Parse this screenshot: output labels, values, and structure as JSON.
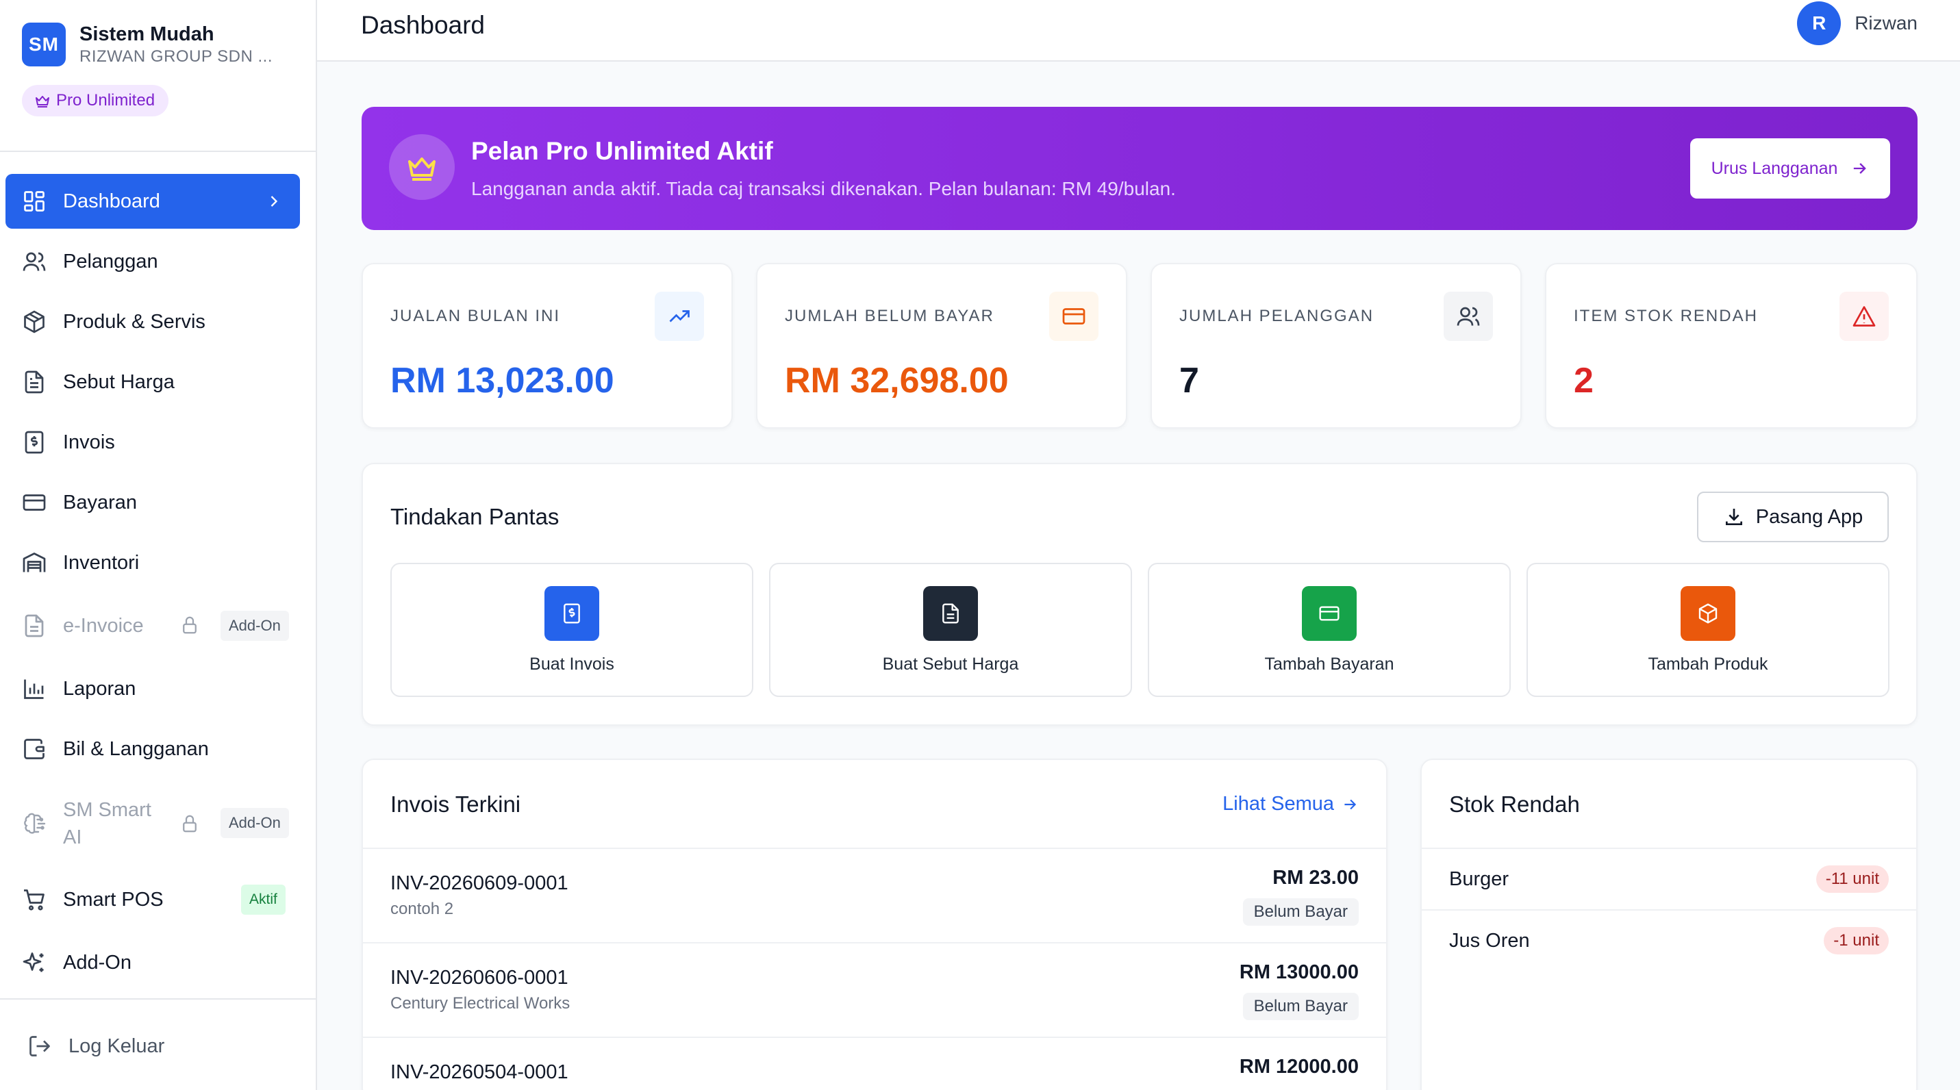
{
  "brand": {
    "logo_text": "SM",
    "name": "Sistem Mudah",
    "company": "RIZWAN GROUP SDN ...",
    "plan_badge": "Pro Unlimited"
  },
  "sidebar": {
    "items": [
      {
        "label": "Dashboard",
        "icon": "grid-icon",
        "active": true
      },
      {
        "label": "Pelanggan",
        "icon": "users-icon"
      },
      {
        "label": "Produk & Servis",
        "icon": "box-icon"
      },
      {
        "label": "Sebut Harga",
        "icon": "document-icon"
      },
      {
        "label": "Invois",
        "icon": "invoice-icon"
      },
      {
        "label": "Bayaran",
        "icon": "credit-card-icon"
      },
      {
        "label": "Inventori",
        "icon": "warehouse-icon"
      },
      {
        "label": "e-Invoice",
        "icon": "document-icon",
        "locked": true,
        "tag": "Add-On"
      },
      {
        "label": "Laporan",
        "icon": "bar-chart-icon"
      },
      {
        "label": "Bil & Langganan",
        "icon": "wallet-icon"
      },
      {
        "label_line1": "SM Smart",
        "label_line2": "AI",
        "icon": "brain-icon",
        "locked": true,
        "tag": "Add-On"
      },
      {
        "label": "Smart POS",
        "icon": "cart-icon",
        "tag": "Aktif"
      },
      {
        "label": "Add-On",
        "icon": "sparkles-icon"
      }
    ],
    "logout_label": "Log Keluar"
  },
  "header": {
    "title": "Dashboard",
    "user_initial": "R",
    "user_name": "Rizwan"
  },
  "banner": {
    "title": "Pelan Pro Unlimited Aktif",
    "description": "Langganan anda aktif. Tiada caj transaksi dikenakan. Pelan bulanan: RM 49/bulan.",
    "button_label": "Urus Langganan"
  },
  "stats": [
    {
      "label": "JUALAN BULAN INI",
      "value": "RM 13,023.00",
      "icon": "trending-up-icon",
      "color": "#2563eb"
    },
    {
      "label": "JUMLAH BELUM BAYAR",
      "value": "RM 32,698.00",
      "icon": "credit-card-icon",
      "color": "#ea580c"
    },
    {
      "label": "JUMLAH PELANGGAN",
      "value": "7",
      "icon": "users-icon",
      "color": "#111827"
    },
    {
      "label": "ITEM STOK RENDAH",
      "value": "2",
      "icon": "alert-triangle-icon",
      "color": "#dc2626"
    }
  ],
  "quick_actions": {
    "title": "Tindakan Pantas",
    "install_label": "Pasang App",
    "items": [
      {
        "label": "Buat Invois",
        "icon": "invoice-icon",
        "color": "#2563eb"
      },
      {
        "label": "Buat Sebut Harga",
        "icon": "document-icon",
        "color": "#1f2937"
      },
      {
        "label": "Tambah Bayaran",
        "icon": "credit-card-icon",
        "color": "#16a34a"
      },
      {
        "label": "Tambah Produk",
        "icon": "box-icon",
        "color": "#ea580c"
      }
    ]
  },
  "recent_invoices": {
    "title": "Invois Terkini",
    "see_all": "Lihat Semua",
    "rows": [
      {
        "number": "INV-20260609-0001",
        "customer": "contoh 2",
        "amount": "RM 23.00",
        "status": "Belum Bayar"
      },
      {
        "number": "INV-20260606-0001",
        "customer": "Century Electrical Works",
        "amount": "RM 13000.00",
        "status": "Belum Bayar"
      },
      {
        "number": "INV-20260504-0001",
        "customer": "",
        "amount": "RM 12000.00",
        "status": ""
      }
    ]
  },
  "low_stock": {
    "title": "Stok Rendah",
    "items": [
      {
        "name": "Burger",
        "qty": "-11 unit"
      },
      {
        "name": "Jus Oren",
        "qty": "-1 unit"
      }
    ]
  }
}
